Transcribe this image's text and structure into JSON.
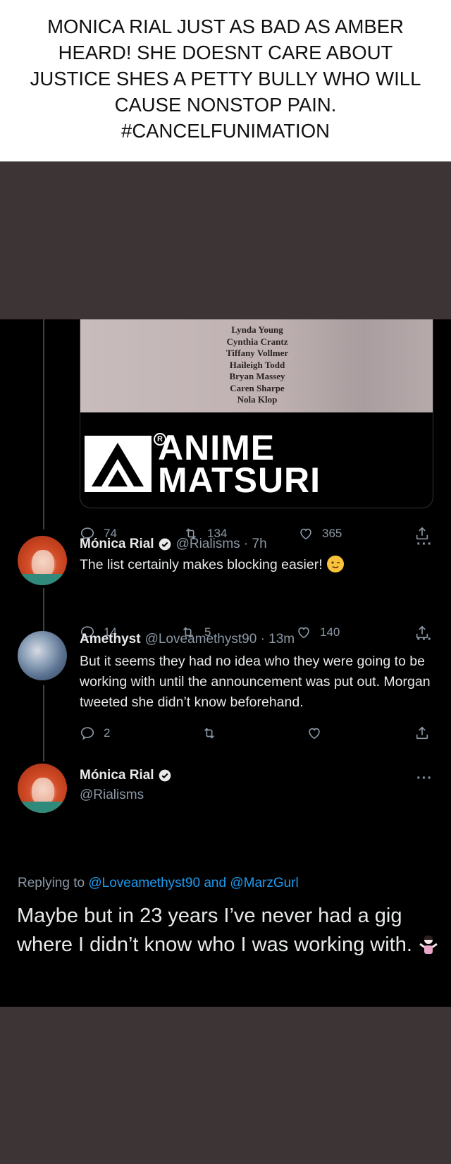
{
  "caption": "MONICA RIAL JUST AS BAD AS AMBER HEARD!  SHE DOESNT CARE ABOUT JUSTICE SHES A PETTY BULLY WHO WILL CAUSE NONSTOP PAIN. #CANCELFUNIMATION",
  "media": {
    "credits": [
      "Lynda Young",
      "Cynthia Crantz",
      "Tiffany Vollmer",
      "Haileigh Todd",
      "Bryan Massey",
      "Caren Sharpe",
      "Nola Klop"
    ],
    "logo_line1": "ANIME",
    "logo_line2": "MATSURI",
    "logo_reg": "R"
  },
  "tweet_original": {
    "replies": "74",
    "retweets": "134",
    "likes": "365"
  },
  "tweet_monica1": {
    "name": "Mónica Rial",
    "handle": "@Rialisms · 7h",
    "text": "The list certainly makes blocking easier!",
    "replies": "14",
    "retweets": "5",
    "likes": "140"
  },
  "tweet_amethyst": {
    "name": "Amethyst",
    "handle": "@Loveamethyst90 · 13m",
    "text": "But it seems they had no idea who they were going to be working with until the announcement was put out. Morgan tweeted she didn’t know beforehand.",
    "replies": "2"
  },
  "tweet_monica2": {
    "name": "Mónica Rial",
    "handle": "@Rialisms",
    "replying_prefix": "Replying to",
    "mention1": "@Loveamethyst90",
    "and": "and",
    "mention2": "@MarzGurl",
    "text": "Maybe but in 23 years I’ve never had a gig where I didn’t know who I was working with."
  },
  "more_label": "···",
  "colors": {
    "background": "#3d3535",
    "tweet_bg": "#000000",
    "text": "#e7e9ea",
    "muted": "#8b98a5",
    "link": "#1d9bf0"
  }
}
